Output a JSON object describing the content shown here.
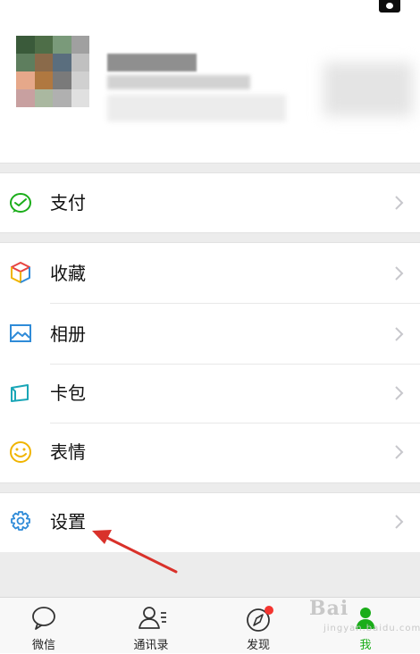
{
  "profile": {
    "avatar_colors": [
      "#3a5a3a",
      "#4e6e48",
      "#7a9a7a",
      "#a0a0a0",
      "#5e7e5e",
      "#8a6a4a",
      "#5a6e7e",
      "#c0c0c0",
      "#e6a88a",
      "#b07840",
      "#7a7a7a",
      "#d0d0d0",
      "#c8a0a0",
      "#aab8a0",
      "#b0b0b0",
      "#e0e0e0",
      "#ffffff",
      "#ffffff",
      "#ffffff",
      "#ffffff"
    ]
  },
  "menu": {
    "pay": "支付",
    "favorites": "收藏",
    "album": "相册",
    "wallet": "卡包",
    "stickers": "表情",
    "settings": "设置"
  },
  "tabs": {
    "chats": "微信",
    "contacts": "通讯录",
    "discover": "发现",
    "me": "我"
  },
  "watermark": {
    "brand": "Bai",
    "sub": "jingyan.baidu.com"
  },
  "colors": {
    "accent_green": "#1aad19",
    "badge_red": "#f43530",
    "arrow_red": "#d9312a"
  }
}
